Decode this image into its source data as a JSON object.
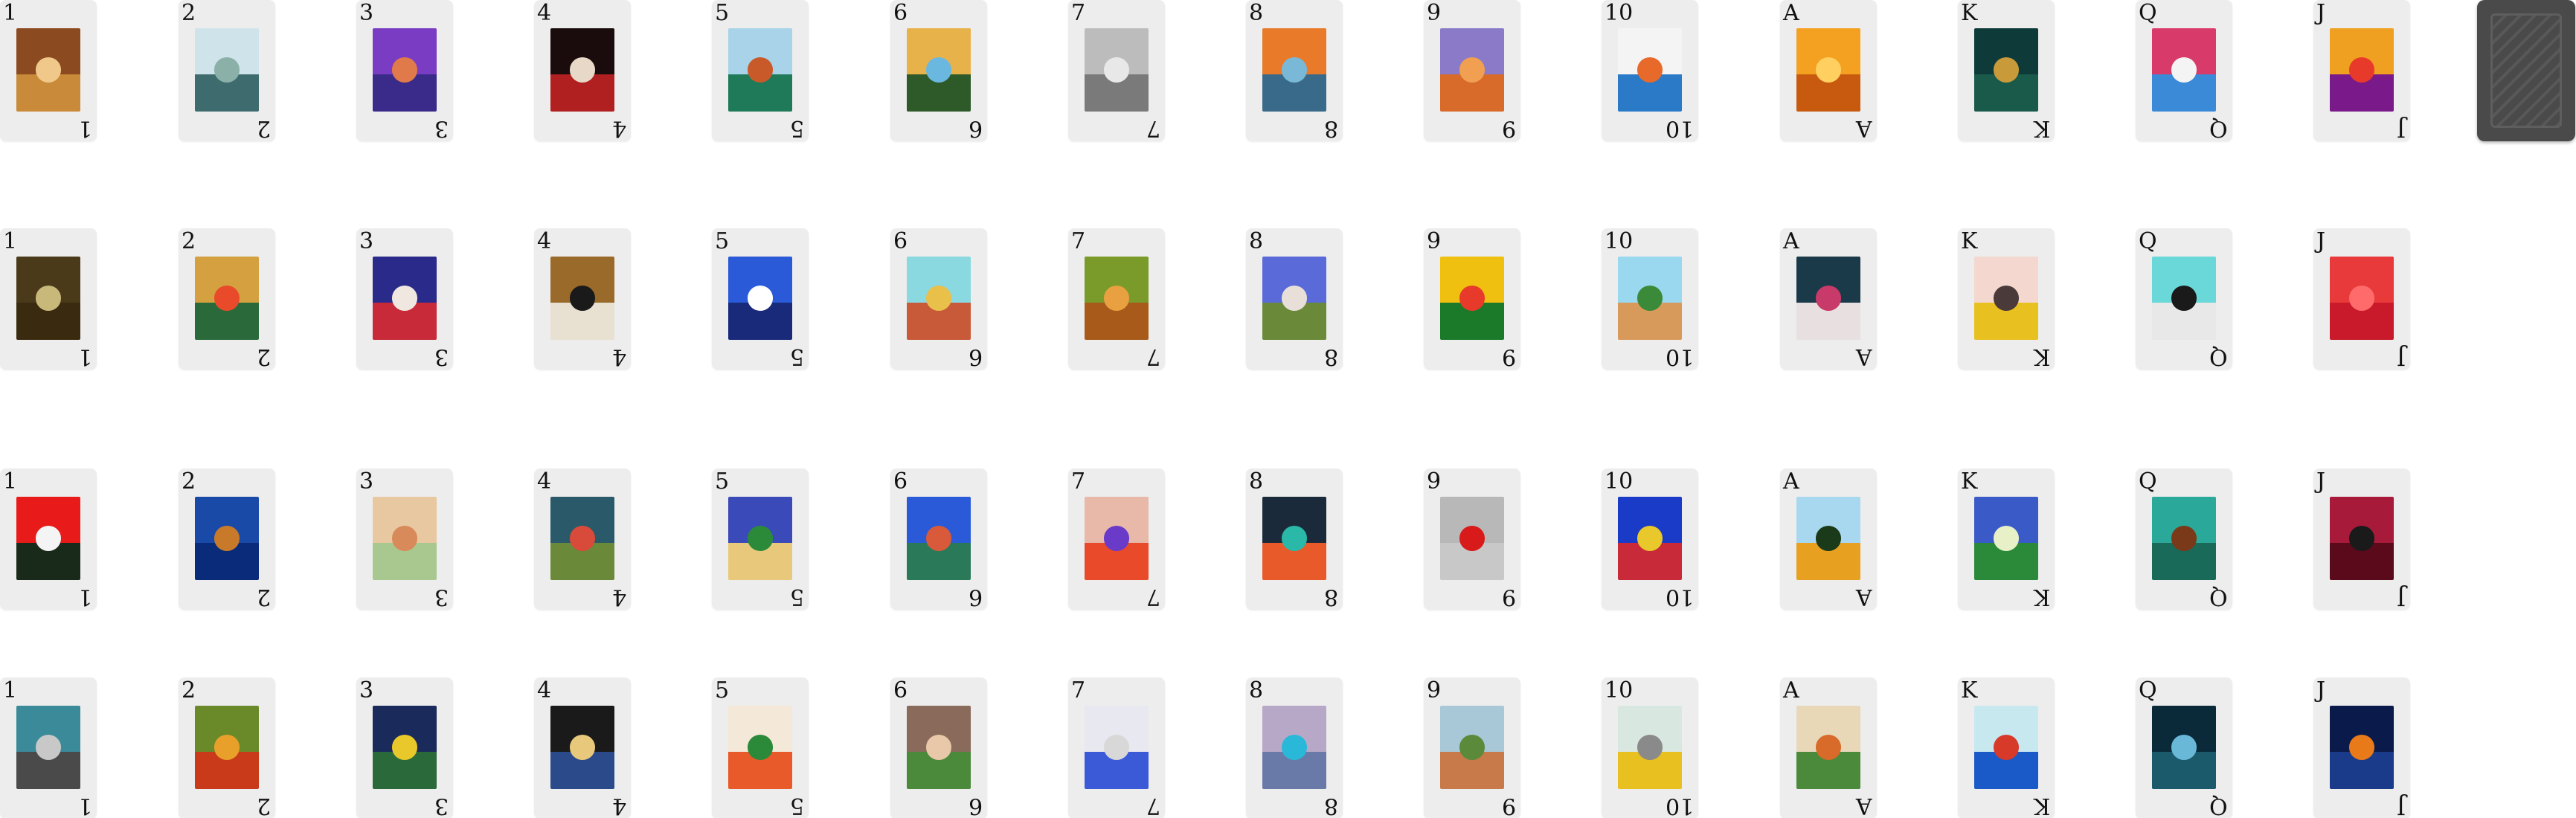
{
  "rows": [
    {
      "cards": [
        {
          "rank": "1",
          "art": {
            "top": "#8b4a1f",
            "bottom": "#c98a3a",
            "accent": "#f0c98a"
          }
        },
        {
          "rank": "2",
          "art": {
            "top": "#cfe3ea",
            "bottom": "#3e6b6e",
            "accent": "#8ab0a8"
          }
        },
        {
          "rank": "3",
          "art": {
            "top": "#7a3cc2",
            "bottom": "#3a2a8a",
            "accent": "#e07a4a"
          }
        },
        {
          "rank": "4",
          "art": {
            "top": "#1a0c0c",
            "bottom": "#b12020",
            "accent": "#e8d8c8"
          }
        },
        {
          "rank": "5",
          "art": {
            "top": "#a9d3e8",
            "bottom": "#1f7a5a",
            "accent": "#c85a2a"
          }
        },
        {
          "rank": "6",
          "art": {
            "top": "#e8b24a",
            "bottom": "#2e5a2a",
            "accent": "#6ab8e0"
          }
        },
        {
          "rank": "7",
          "art": {
            "top": "#bcbcbc",
            "bottom": "#7a7a7a",
            "accent": "#e8e8e8"
          }
        },
        {
          "rank": "8",
          "art": {
            "top": "#e87a2a",
            "bottom": "#3a6a8a",
            "accent": "#7ab8d8"
          }
        },
        {
          "rank": "9",
          "art": {
            "top": "#8a7ac8",
            "bottom": "#d86a2a",
            "accent": "#f0a050"
          }
        },
        {
          "rank": "10",
          "art": {
            "top": "#f4f4f4",
            "bottom": "#2a7ac8",
            "accent": "#e86a2a"
          }
        },
        {
          "rank": "A",
          "art": {
            "top": "#f4a020",
            "bottom": "#c85a10",
            "accent": "#ffd060"
          }
        },
        {
          "rank": "K",
          "art": {
            "top": "#0e3a3a",
            "bottom": "#1a5a4a",
            "accent": "#c89a3a"
          }
        },
        {
          "rank": "Q",
          "art": {
            "top": "#d83a6a",
            "bottom": "#3a8ad8",
            "accent": "#f4f4f4"
          }
        },
        {
          "rank": "J",
          "art": {
            "top": "#f0a020",
            "bottom": "#7a1a8a",
            "accent": "#e83a2a"
          }
        }
      ]
    },
    {
      "cards": [
        {
          "rank": "1",
          "art": {
            "top": "#4a3a1a",
            "bottom": "#3a2a10",
            "accent": "#c8b87a"
          }
        },
        {
          "rank": "2",
          "art": {
            "top": "#d4a040",
            "bottom": "#2a6a3a",
            "accent": "#e84a2a"
          }
        },
        {
          "rank": "3",
          "art": {
            "top": "#2a2a8a",
            "bottom": "#c82a3a",
            "accent": "#f0e8e0"
          }
        },
        {
          "rank": "4",
          "art": {
            "top": "#9a6a2a",
            "bottom": "#e8e0d0",
            "accent": "#1a1a1a"
          }
        },
        {
          "rank": "5",
          "art": {
            "top": "#2a5ad8",
            "bottom": "#1a2a7a",
            "accent": "#ffffff"
          }
        },
        {
          "rank": "6",
          "art": {
            "top": "#8ad8e0",
            "bottom": "#c85a3a",
            "accent": "#e8c04a"
          }
        },
        {
          "rank": "7",
          "art": {
            "top": "#7a9a2a",
            "bottom": "#a85a1a",
            "accent": "#e8a040"
          }
        },
        {
          "rank": "8",
          "art": {
            "top": "#5a6ad8",
            "bottom": "#6a8a3a",
            "accent": "#e8e0d8"
          }
        },
        {
          "rank": "9",
          "art": {
            "top": "#f0c010",
            "bottom": "#1a7a2a",
            "accent": "#e83a2a"
          }
        },
        {
          "rank": "10",
          "art": {
            "top": "#9ad8f0",
            "bottom": "#d89a5a",
            "accent": "#3a8a3a"
          }
        },
        {
          "rank": "A",
          "art": {
            "top": "#1a3a4a",
            "bottom": "#e8e0e0",
            "accent": "#c83a6a"
          }
        },
        {
          "rank": "K",
          "art": {
            "top": "#f4d8d0",
            "bottom": "#e8c020",
            "accent": "#4a3a3a"
          }
        },
        {
          "rank": "Q",
          "art": {
            "top": "#6ad8d8",
            "bottom": "#e8e8e8",
            "accent": "#1a1a1a"
          }
        },
        {
          "rank": "J",
          "art": {
            "top": "#e83a3a",
            "bottom": "#c81a2a",
            "accent": "#ff6a6a"
          }
        }
      ]
    },
    {
      "cards": [
        {
          "rank": "1",
          "art": {
            "top": "#e81a1a",
            "bottom": "#1a2a1a",
            "accent": "#f4f4f4"
          }
        },
        {
          "rank": "2",
          "art": {
            "top": "#1a4aa8",
            "bottom": "#0a2a7a",
            "accent": "#c87a2a"
          }
        },
        {
          "rank": "3",
          "art": {
            "top": "#e8c8a0",
            "bottom": "#a8c890",
            "accent": "#d88a5a"
          }
        },
        {
          "rank": "4",
          "art": {
            "top": "#2a5a6a",
            "bottom": "#6a8a3a",
            "accent": "#d84a3a"
          }
        },
        {
          "rank": "5",
          "art": {
            "top": "#3a4ab8",
            "bottom": "#e8c87a",
            "accent": "#2a8a3a"
          }
        },
        {
          "rank": "6",
          "art": {
            "top": "#2a5ad8",
            "bottom": "#2a7a5a",
            "accent": "#d85a3a"
          }
        },
        {
          "rank": "7",
          "art": {
            "top": "#e8b8a8",
            "bottom": "#e84a2a",
            "accent": "#6a3ac8"
          }
        },
        {
          "rank": "8",
          "art": {
            "top": "#1a2a3a",
            "bottom": "#e85a2a",
            "accent": "#2ab8a8"
          }
        },
        {
          "rank": "9",
          "art": {
            "top": "#b8b8b8",
            "bottom": "#c8c8c8",
            "accent": "#d81a1a"
          }
        },
        {
          "rank": "10",
          "art": {
            "top": "#1a3ac8",
            "bottom": "#c82a3a",
            "accent": "#e8c82a"
          }
        },
        {
          "rank": "A",
          "art": {
            "top": "#a8d8f0",
            "bottom": "#e8a020",
            "accent": "#1a3a1a"
          }
        },
        {
          "rank": "K",
          "art": {
            "top": "#3a5ac8",
            "bottom": "#2a8a3a",
            "accent": "#e8f0c8"
          }
        },
        {
          "rank": "Q",
          "art": {
            "top": "#2aa89a",
            "bottom": "#1a6a5a",
            "accent": "#7a3a1a"
          }
        },
        {
          "rank": "J",
          "art": {
            "top": "#a81a3a",
            "bottom": "#5a0a1a",
            "accent": "#1a1a1a"
          }
        }
      ]
    },
    {
      "cards": [
        {
          "rank": "1",
          "art": {
            "top": "#3a8a9a",
            "bottom": "#4a4a4a",
            "accent": "#c8c8c8"
          }
        },
        {
          "rank": "2",
          "art": {
            "top": "#6a8a2a",
            "bottom": "#c83a1a",
            "accent": "#e8a02a"
          }
        },
        {
          "rank": "3",
          "art": {
            "top": "#1a2a5a",
            "bottom": "#2a6a3a",
            "accent": "#e8c82a"
          }
        },
        {
          "rank": "4",
          "art": {
            "top": "#1a1a1a",
            "bottom": "#2a4a8a",
            "accent": "#e8c87a"
          }
        },
        {
          "rank": "5",
          "art": {
            "top": "#f4e8d8",
            "bottom": "#e85a2a",
            "accent": "#2a8a3a"
          }
        },
        {
          "rank": "6",
          "art": {
            "top": "#8a6a5a",
            "bottom": "#4a8a3a",
            "accent": "#e8c8a8"
          }
        },
        {
          "rank": "7",
          "art": {
            "top": "#e8e8f0",
            "bottom": "#3a5ad8",
            "accent": "#d8d8d8"
          }
        },
        {
          "rank": "8",
          "art": {
            "top": "#b8a8c8",
            "bottom": "#6a7aa8",
            "accent": "#2ab8d8"
          }
        },
        {
          "rank": "9",
          "art": {
            "top": "#a8c8d8",
            "bottom": "#c87a4a",
            "accent": "#5a8a3a"
          }
        },
        {
          "rank": "10",
          "art": {
            "top": "#d8e8e0",
            "bottom": "#e8c020",
            "accent": "#8a8a8a"
          }
        },
        {
          "rank": "A",
          "art": {
            "top": "#e8d8b8",
            "bottom": "#4a8a3a",
            "accent": "#d86a2a"
          }
        },
        {
          "rank": "K",
          "art": {
            "top": "#c8e8f0",
            "bottom": "#1a5ac8",
            "accent": "#d83a2a"
          }
        },
        {
          "rank": "Q",
          "art": {
            "top": "#0a2a3a",
            "bottom": "#1a5a6a",
            "accent": "#6ab8d8"
          }
        },
        {
          "rank": "J",
          "art": {
            "top": "#0a1a4a",
            "bottom": "#1a3a8a",
            "accent": "#e87a1a"
          }
        }
      ]
    }
  ],
  "deck": {
    "label": ""
  }
}
